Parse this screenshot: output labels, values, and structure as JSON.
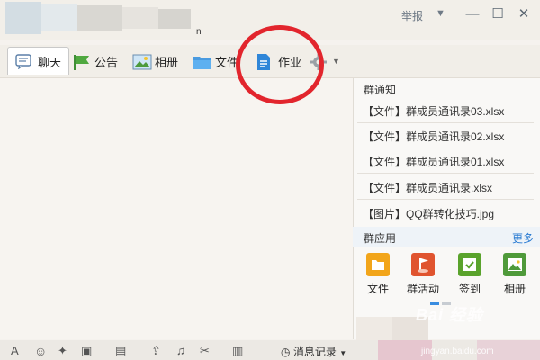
{
  "window": {
    "report_label": "举报",
    "caret": "▼",
    "minimize": "—",
    "maximize": "☐",
    "close": "✕",
    "subtitle": "n"
  },
  "tabs": [
    {
      "label": "聊天",
      "icon": "chat-icon"
    },
    {
      "label": "公告",
      "icon": "announcement-flag-icon"
    },
    {
      "label": "相册",
      "icon": "photo-album-icon"
    },
    {
      "label": "文件",
      "icon": "folder-icon"
    },
    {
      "label": "作业",
      "icon": "homework-document-icon"
    },
    {
      "label": "",
      "icon": "gear-icon"
    }
  ],
  "more_caret": "▼",
  "group_notice": {
    "title": "群通知",
    "items": [
      "【文件】群成员通讯录03.xlsx",
      "【文件】群成员通讯录02.xlsx",
      "【文件】群成员通讯录01.xlsx",
      "【文件】群成员通讯录.xlsx",
      "【图片】QQ群转化技巧.jpg"
    ]
  },
  "group_apps": {
    "title": "群应用",
    "more": "更多",
    "apps": [
      {
        "label": "文件",
        "icon": "folder-app-icon",
        "color": "#f2a51a"
      },
      {
        "label": "群活动",
        "icon": "activity-flag-icon",
        "color": "#e0542f"
      },
      {
        "label": "签到",
        "icon": "checkin-icon",
        "color": "#5aa32c"
      },
      {
        "label": "相册",
        "icon": "album-app-icon",
        "color": "#4f9a3a"
      }
    ]
  },
  "bottom_toolbar": {
    "font": "A",
    "emoji": "☺",
    "history": "消息记录",
    "caret": "▼"
  },
  "watermark": {
    "brand": "Bai 经验",
    "url": "jingyan.baidu.com"
  },
  "colors": {
    "annotation_circle": "#e2252d",
    "link": "#2a7bd2"
  }
}
